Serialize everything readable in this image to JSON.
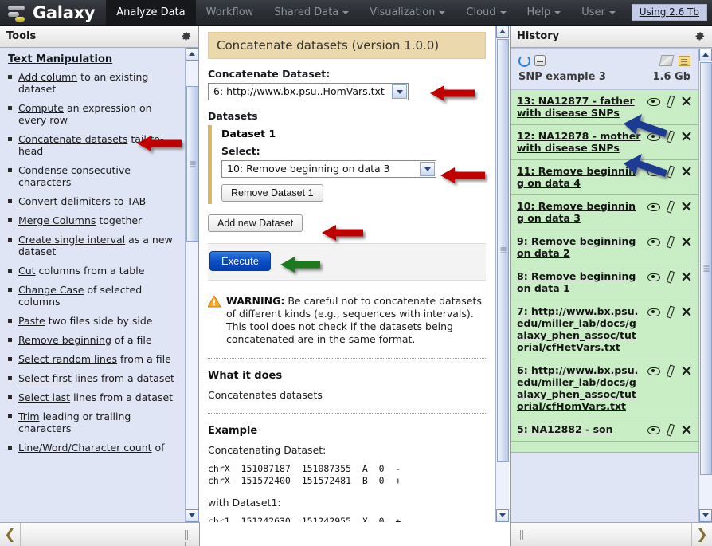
{
  "masthead": {
    "brand": "Galaxy",
    "nav": [
      {
        "label": "Analyze Data",
        "active": true,
        "dropdown": false
      },
      {
        "label": "Workflow",
        "active": false,
        "dropdown": false
      },
      {
        "label": "Shared Data",
        "active": false,
        "dropdown": true
      },
      {
        "label": "Visualization",
        "active": false,
        "dropdown": true
      },
      {
        "label": "Cloud",
        "active": false,
        "dropdown": true
      },
      {
        "label": "Help",
        "active": false,
        "dropdown": true
      },
      {
        "label": "User",
        "active": false,
        "dropdown": true
      }
    ],
    "quota": "Using 2.6 Tb"
  },
  "tools_panel": {
    "title": "Tools",
    "section_title": "Text Manipulation",
    "items": [
      {
        "link": "Add column",
        "rest": " to an existing dataset"
      },
      {
        "link": "Compute",
        "rest": " an expression on every row"
      },
      {
        "link": "Concatenate datasets",
        "rest": " tail-to-head"
      },
      {
        "link": "Condense",
        "rest": " consecutive characters"
      },
      {
        "link": "Convert",
        "rest": " delimiters to TAB"
      },
      {
        "link": "Merge Columns",
        "rest": " together"
      },
      {
        "link": "Create single interval",
        "rest": " as a new dataset"
      },
      {
        "link": "Cut",
        "rest": " columns from a table"
      },
      {
        "link": "Change Case",
        "rest": " of selected columns"
      },
      {
        "link": "Paste",
        "rest": " two files side by side"
      },
      {
        "link": "Remove beginning",
        "rest": " of a file"
      },
      {
        "link": "Select random lines",
        "rest": " from a file"
      },
      {
        "link": "Select first",
        "rest": " lines from a dataset"
      },
      {
        "link": "Select last",
        "rest": " lines from a dataset"
      },
      {
        "link": "Trim",
        "rest": " leading or trailing characters"
      },
      {
        "link": "Line/Word/Character count",
        "rest": " of"
      }
    ]
  },
  "tool_form": {
    "header": "Concatenate datasets (version 1.0.0)",
    "concat_label": "Concatenate Dataset:",
    "concat_value": "6: http://www.bx.psu..HomVars.txt",
    "datasets_label": "Datasets",
    "dataset1_title": "Dataset 1",
    "select_label": "Select:",
    "select_value": "10: Remove beginning on data 3",
    "remove_button": "Remove Dataset 1",
    "add_button": "Add new Dataset",
    "execute_button": "Execute",
    "warning_prefix": "WARNING:",
    "warning_text": " Be careful not to concatenate datasets of different kinds (e.g., sequences with intervals). This tool does not check if the datasets being concatenated are in the same format.",
    "what_it_does_title": "What it does",
    "what_it_does_text": "Concatenates datasets",
    "example_title": "Example",
    "example_lead": "Concatenating Dataset:",
    "example_block1": "chrX  151087187  151087355  A  0  -\nchrX  151572400  151572481  B  0  +",
    "example_mid": "with Dataset1:",
    "example_block2": "chr1  151242630  151242955  X  0  +"
  },
  "history": {
    "title": "History",
    "name": "SNP example 3",
    "size": "1.6 Gb",
    "items": [
      {
        "title": "13: NA12877 - father with disease SNPs"
      },
      {
        "title": "12: NA12878 - mother with disease SNPs"
      },
      {
        "title": "11: Remove beginning on data 4"
      },
      {
        "title": "10: Remove beginning on data 3"
      },
      {
        "title": "9: Remove beginning on data 2"
      },
      {
        "title": "8: Remove beginning on data 1"
      },
      {
        "title": "7: http://www.bx.psu.edu/miller_lab/docs/galaxy_phen_assoc/tutorial/cfHetVars.txt"
      },
      {
        "title": "6: http://www.bx.psu.edu/miller_lab/docs/galaxy_phen_assoc/tutorial/cfHomVars.txt"
      },
      {
        "title": "5: NA12882 - son"
      }
    ]
  },
  "colors": {
    "masthead_bg": "#2b2e34",
    "tool_panel_bg": "#dfe5f5",
    "history_item_bg": "#c9eec5",
    "tool_header_bg": "#ebd9ad",
    "execute_blue": "#0d4fc4",
    "arrow_red": "#c00000",
    "arrow_green": "#1a7a1a",
    "arrow_blue": "#1f3a93"
  },
  "annotations": [
    {
      "name": "arrow-to-concatenate-datasets-tool",
      "color": "#c00000"
    },
    {
      "name": "arrow-to-concatenate-dataset-select",
      "color": "#c00000"
    },
    {
      "name": "arrow-to-dataset1-select",
      "color": "#c00000"
    },
    {
      "name": "arrow-to-add-new-dataset",
      "color": "#c00000"
    },
    {
      "name": "arrow-to-execute",
      "color": "#1a7a1a"
    },
    {
      "name": "arrow-to-history-item-13",
      "color": "#1f3a93"
    },
    {
      "name": "arrow-to-history-item-12",
      "color": "#1f3a93"
    }
  ]
}
